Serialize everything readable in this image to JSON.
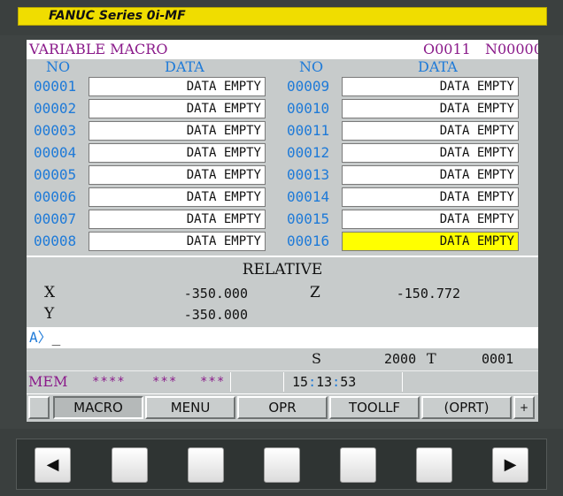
{
  "title_bar": {
    "text": "FANUC Series 0i-MF"
  },
  "header": {
    "title": "VARIABLE MACRO",
    "program": "O0011",
    "sequence": "N00000"
  },
  "table": {
    "col_no": "NO",
    "col_data": "DATA",
    "left": [
      {
        "no": "00001",
        "value": "DATA EMPTY"
      },
      {
        "no": "00002",
        "value": "DATA EMPTY"
      },
      {
        "no": "00003",
        "value": "DATA EMPTY"
      },
      {
        "no": "00004",
        "value": "DATA EMPTY"
      },
      {
        "no": "00005",
        "value": "DATA EMPTY"
      },
      {
        "no": "00006",
        "value": "DATA EMPTY"
      },
      {
        "no": "00007",
        "value": "DATA EMPTY"
      },
      {
        "no": "00008",
        "value": "DATA EMPTY"
      }
    ],
    "right": [
      {
        "no": "00009",
        "value": "DATA EMPTY"
      },
      {
        "no": "00010",
        "value": "DATA EMPTY"
      },
      {
        "no": "00011",
        "value": "DATA EMPTY"
      },
      {
        "no": "00012",
        "value": "DATA EMPTY"
      },
      {
        "no": "00013",
        "value": "DATA EMPTY"
      },
      {
        "no": "00014",
        "value": "DATA EMPTY"
      },
      {
        "no": "00015",
        "value": "DATA EMPTY"
      },
      {
        "no": "00016",
        "value": "DATA EMPTY"
      }
    ],
    "selected": "00016"
  },
  "relative": {
    "title": "RELATIVE",
    "x_label": "X",
    "x_value": "-350.000",
    "y_label": "Y",
    "y_value": "-350.000",
    "z_label": "Z",
    "z_value": "-150.772"
  },
  "input": {
    "prompt": "A",
    "arrow": "〉",
    "cursor": "_"
  },
  "status": {
    "s_label": "S",
    "s_value": "2000",
    "t_label": "T",
    "t_value": "0001"
  },
  "mode": {
    "mem": "MEM",
    "stars1": "****",
    "stars2": "***",
    "stars3": "***",
    "time_h": "15",
    "time_m": "13",
    "time_s": "53",
    "time_sep": ":"
  },
  "softkeys": {
    "left_blank": "",
    "k1": "MACRO",
    "k2": "MENU",
    "k3": "OPR",
    "k4": "TOOLLF",
    "k5": "(OPRT)",
    "plus": "+"
  },
  "hardkeys": {
    "left": "◀",
    "right": "▶"
  },
  "colors": {
    "title_yellow": "#f0dd00",
    "magenta": "#8a1a8a",
    "number_blue": "#1e7ad8",
    "highlight": "#ffff00",
    "screen_gray": "#c7cbcb"
  }
}
